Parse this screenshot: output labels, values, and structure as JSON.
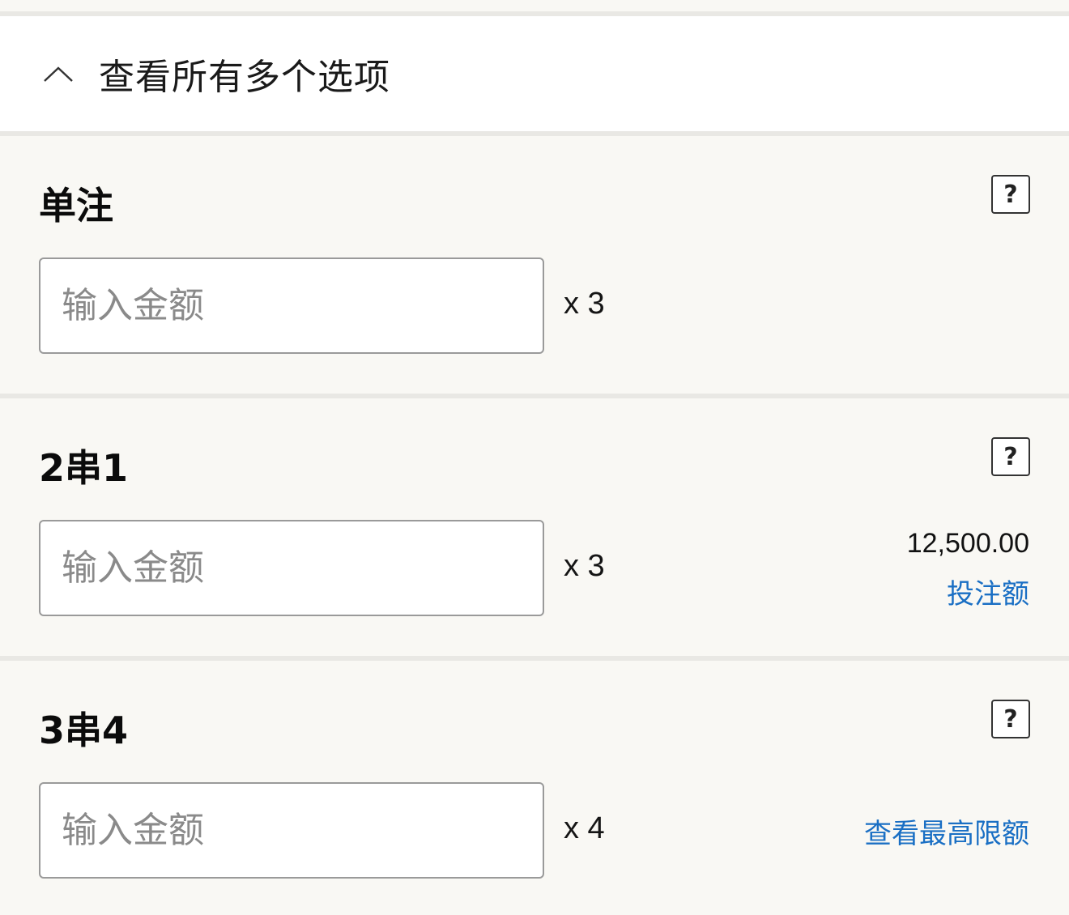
{
  "header": {
    "title": "查看所有多个选项",
    "chevron_icon": "chevron-up-icon"
  },
  "bets": [
    {
      "title": "单注",
      "input_placeholder": "输入金额",
      "input_value": "",
      "multiplier": "x 3",
      "help_icon": "question-mark-icon",
      "help_label": "?"
    },
    {
      "title": "2串1",
      "input_placeholder": "输入金额",
      "input_value": "",
      "multiplier": "x 3",
      "help_icon": "question-mark-icon",
      "help_label": "?",
      "max_amount": "12,500.00",
      "stake_label": "投注额"
    },
    {
      "title": "3串4",
      "input_placeholder": "输入金额",
      "input_value": "",
      "multiplier": "x 4",
      "help_icon": "question-mark-icon",
      "help_label": "?",
      "max_link": "查看最高限额"
    }
  ],
  "colors": {
    "background": "#f9f8f4",
    "header_bg": "#ffffff",
    "divider": "#e9e8e4",
    "link": "#1a6fc4",
    "input_border": "#9a9a9a"
  }
}
